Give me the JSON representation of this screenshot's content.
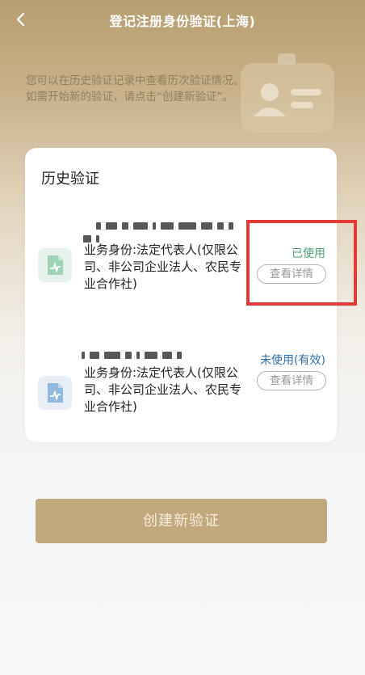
{
  "header": {
    "title": "登记注册身份验证(上海)",
    "back_icon": "chevron-left-icon"
  },
  "tip": "您可以在历史验证记录中查看历次验证情况。如需开始新的验证，请点击“创建新验证”。",
  "history": {
    "title": "历史验证",
    "records": [
      {
        "identity": "业务身份:法定代表人(仅限公司、非公司企业法人、农民专业合作社)",
        "status": "已使用",
        "status_color": "#4aa274",
        "detail_label": "查看详情"
      },
      {
        "identity": "业务身份:法定代表人(仅限公司、非公司企业法人、农民专业合作社)",
        "status": "未使用(有效)",
        "status_color": "#2f6fb0",
        "detail_label": "查看详情"
      }
    ]
  },
  "create_button": "创建新验证",
  "colors": {
    "brand_gold": "#c2a97d",
    "highlight_red": "#e43a3a"
  }
}
